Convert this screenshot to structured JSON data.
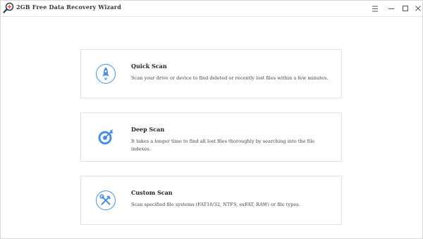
{
  "window": {
    "title": "2GB Free Data Recovery Wizard",
    "logo_icon": "magnifier-plus-icon",
    "controls": {
      "menu_icon": "hamburger-menu-icon",
      "minimize_icon": "minimize-icon",
      "maximize_icon": "maximize-icon",
      "close_icon": "close-icon"
    }
  },
  "scan_options": [
    {
      "title": "Quick Scan",
      "description": "Scan your drive or device to find deleted or recently lost files within a few minutes.",
      "icon": "rocket-icon"
    },
    {
      "title": "Deep Scan",
      "description": "It takes a longer time to find all lost files thoroughly by searching into the file indexes.",
      "icon": "target-icon"
    },
    {
      "title": "Custom Scan",
      "description": "Scan specified file systems (FAT16/32, NTFS, exFAT, RAW) or file types.",
      "icon": "tools-icon"
    }
  ],
  "colors": {
    "accent": "#4a90d9",
    "border": "#e2e2e2"
  }
}
